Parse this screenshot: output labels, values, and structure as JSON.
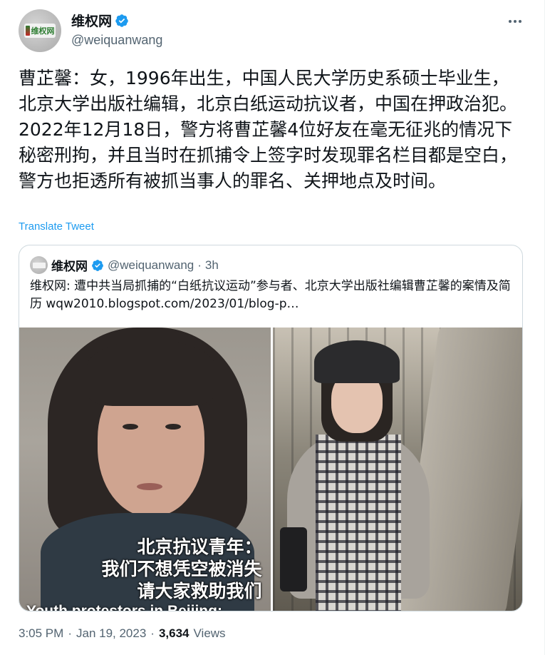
{
  "author": {
    "name": "维权网",
    "handle": "@weiquanwang",
    "avatar_text": "维权网",
    "verified": true
  },
  "tweet": {
    "text": "曹芷馨：女，1996年出生，中国人民大学历史系硕士毕业生，北京大学出版社编辑，北京白纸运动抗议者，中国在押政治犯。2022年12月18日，警方将曹芷馨4位好友在毫无征兆的情况下秘密刑拘，并且当时在抓捕令上签字时发现罪名栏目都是空白，警方也拒透所有被抓当事人的罪名、关押地点及时间。",
    "translate_label": "Translate Tweet"
  },
  "quoted": {
    "name": "维权网",
    "handle": "@weiquanwang",
    "separator": "·",
    "time": "3h",
    "text": "维权网: 遭中共当局抓捕的“白纸抗议运动”参与者、北京大学出版社编辑曹芷馨的案情及简历 wqw2010.blogspot.com/2023/01/blog-p…",
    "media": {
      "left_caption_line1": "北京抗议青年：",
      "left_caption_line2": "我们不想凭空被消失",
      "left_caption_line3": "请大家救助我们",
      "left_caption_en": "Youth protestors in Beijing:"
    }
  },
  "meta": {
    "time": "3:05 PM",
    "separator": "·",
    "date": "Jan 19, 2023",
    "separator2": "·",
    "views_count": "3,634",
    "views_label": "Views"
  },
  "colors": {
    "accent": "#1d9bf0",
    "text": "#0f1419",
    "muted": "#536471",
    "border": "#cfd9de"
  },
  "icons": {
    "verified": "verified-badge-icon",
    "more": "more-horizontal-icon"
  }
}
